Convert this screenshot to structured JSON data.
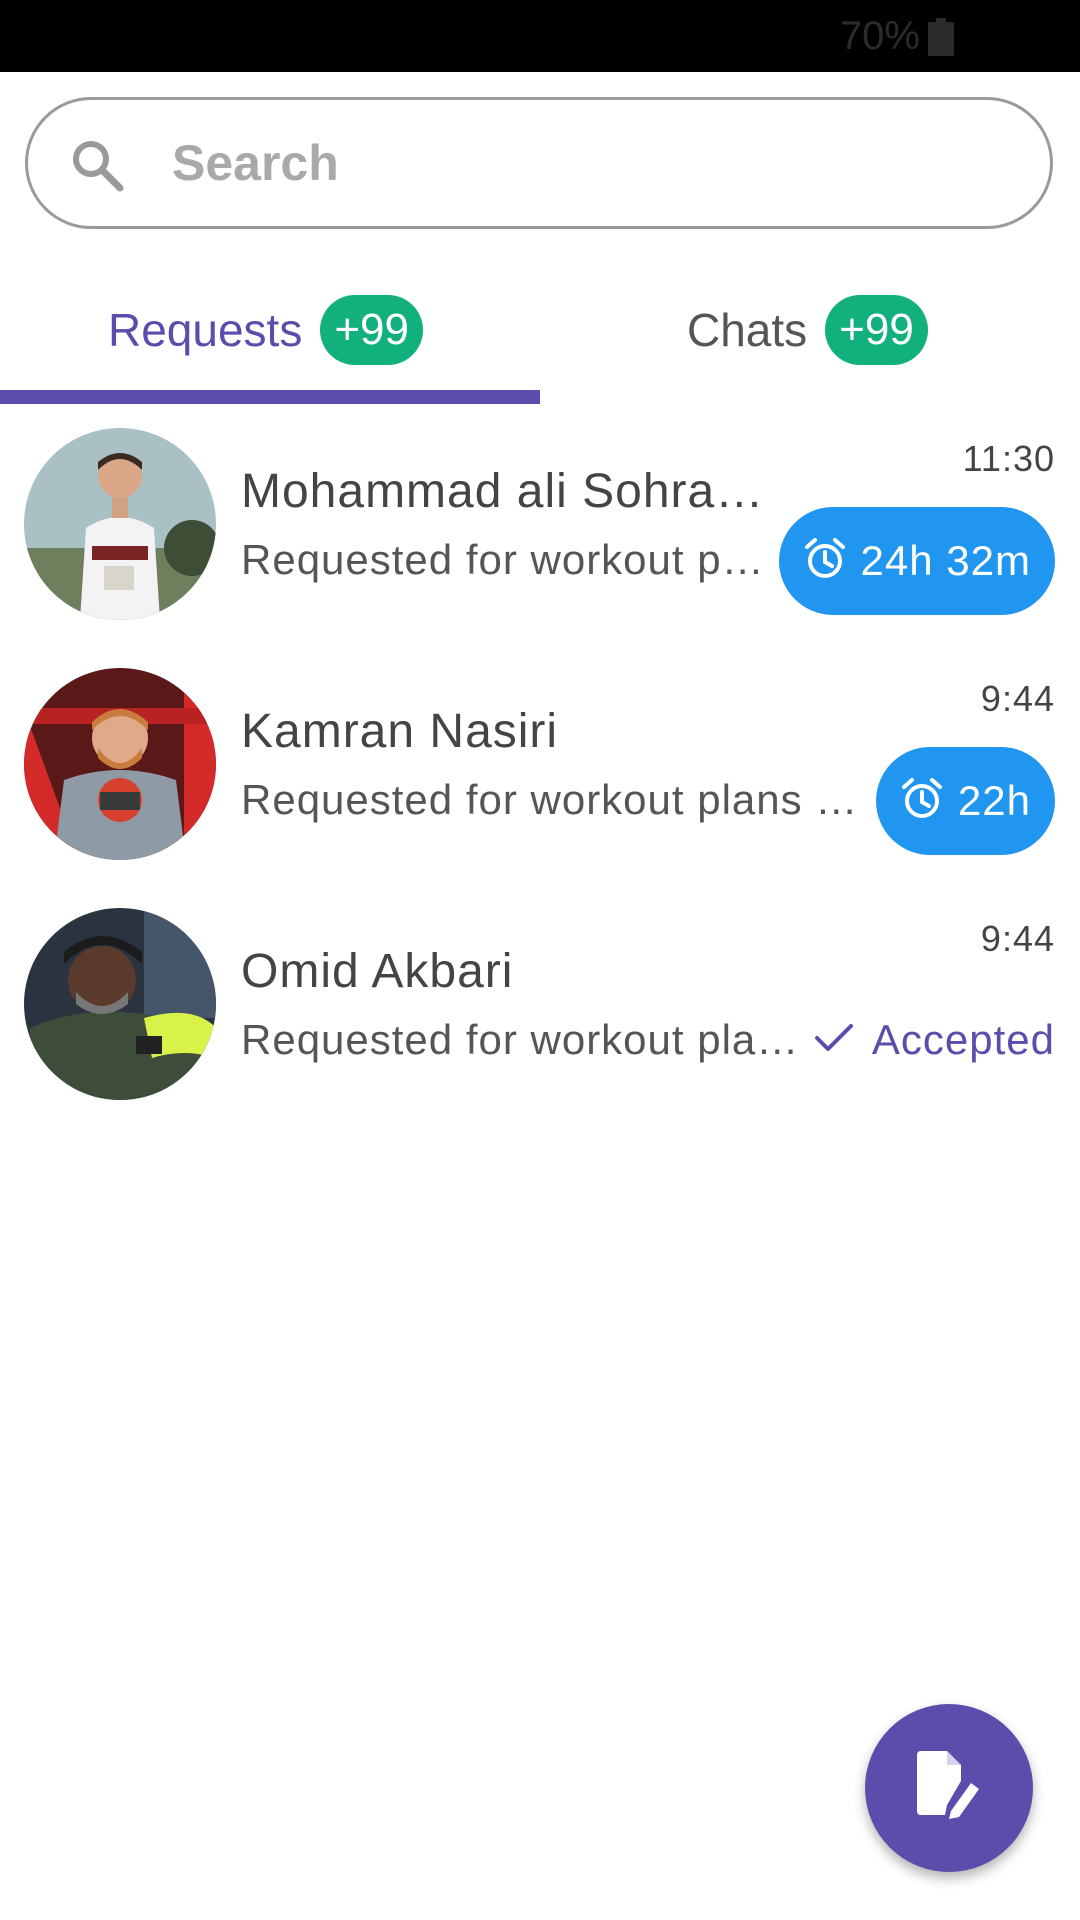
{
  "status_bar": {
    "battery_text": "70%",
    "icon": "battery-icon"
  },
  "search": {
    "placeholder": "Search",
    "value": ""
  },
  "tabs": [
    {
      "label": "Requests",
      "badge": "+99",
      "active": true
    },
    {
      "label": "Chats",
      "badge": "+99",
      "active": false
    }
  ],
  "requests": [
    {
      "name": "Mohammad ali Sohra…",
      "preview": "Requested for workout p…",
      "time": "11:30",
      "status": "timer",
      "timer": "24h 32m"
    },
    {
      "name": "Kamran Nasiri",
      "preview": "Requested for workout plans …",
      "time": "9:44",
      "status": "timer",
      "timer": "22h"
    },
    {
      "name": "Omid Akbari",
      "preview": "Requested for workout pla…",
      "time": "9:44",
      "status": "accepted",
      "status_label": "Accepted"
    }
  ],
  "fab": {
    "icon": "edit-document-icon"
  },
  "colors": {
    "accent": "#5a4dab",
    "badge": "#12b07c",
    "timer": "#2196f0",
    "status_bar": "#000000"
  }
}
